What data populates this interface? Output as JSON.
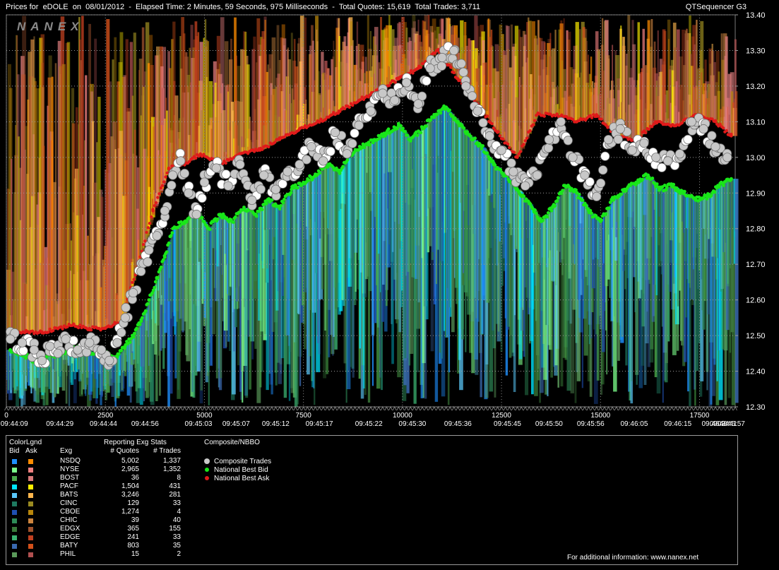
{
  "header": {
    "title_left": "Prices for  eDOLE  on  08/01/2012  -  Elapsed Time: 2 Minutes, 59 Seconds, 975 Milliseconds  -  Total Quotes: 15,619  Total Trades: 3,711",
    "title_right": "QTSequencer G3"
  },
  "watermark": "NANEX",
  "chart_data": {
    "type": "line",
    "y_axis": {
      "min": 12.3,
      "max": 13.4,
      "ticks": [
        "13.40",
        "13.30",
        "13.20",
        "13.10",
        "13.00",
        "12.90",
        "12.80",
        "12.70",
        "12.60",
        "12.50",
        "12.40",
        "12.30"
      ]
    },
    "x_axis": {
      "min": 0,
      "max": 18400,
      "seq_ticks": [
        {
          "v": 0,
          "label": "0"
        },
        {
          "v": 2500,
          "label": "2500"
        },
        {
          "v": 5000,
          "label": "5000"
        },
        {
          "v": 7500,
          "label": "7500"
        },
        {
          "v": 10000,
          "label": "10000"
        },
        {
          "v": 12500,
          "label": "12500"
        },
        {
          "v": 15000,
          "label": "15000"
        },
        {
          "v": 17500,
          "label": "17500"
        }
      ],
      "time_ticks": [
        {
          "v": 200,
          "label": "09:44:09"
        },
        {
          "v": 1350,
          "label": "09:44:29"
        },
        {
          "v": 2450,
          "label": "09:44:44"
        },
        {
          "v": 3500,
          "label": "09:44:56"
        },
        {
          "v": 4850,
          "label": "09:45:03"
        },
        {
          "v": 5800,
          "label": "09:45:07"
        },
        {
          "v": 6800,
          "label": "09:45:12"
        },
        {
          "v": 7900,
          "label": "09:45:17"
        },
        {
          "v": 9150,
          "label": "09:45:22"
        },
        {
          "v": 10250,
          "label": "09:45:30"
        },
        {
          "v": 11400,
          "label": "09:45:36"
        },
        {
          "v": 12650,
          "label": "09:45:45"
        },
        {
          "v": 13700,
          "label": "09:45:50"
        },
        {
          "v": 14750,
          "label": "09:45:56"
        },
        {
          "v": 15850,
          "label": "09:46:05"
        },
        {
          "v": 16950,
          "label": "09:46:15"
        },
        {
          "v": 17900,
          "label": "09:46:24"
        },
        {
          "v": 18100,
          "label": "09:46:41"
        },
        {
          "v": 18300,
          "label": "09:46:57"
        }
      ]
    },
    "series": [
      {
        "name": "Composite Trades",
        "color": "#c8c8c8",
        "points": [
          [
            100,
            12.49
          ],
          [
            400,
            12.48
          ],
          [
            700,
            12.46
          ],
          [
            900,
            12.43
          ],
          [
            1100,
            12.47
          ],
          [
            1300,
            12.45
          ],
          [
            1500,
            12.49
          ],
          [
            1800,
            12.46
          ],
          [
            2100,
            12.48
          ],
          [
            2400,
            12.46
          ],
          [
            2600,
            12.43
          ],
          [
            2800,
            12.48
          ],
          [
            3000,
            12.55
          ],
          [
            3200,
            12.62
          ],
          [
            3400,
            12.68
          ],
          [
            3600,
            12.74
          ],
          [
            3800,
            12.78
          ],
          [
            4000,
            12.85
          ],
          [
            4200,
            12.95
          ],
          [
            4400,
            12.99
          ],
          [
            4600,
            12.9
          ],
          [
            4800,
            12.84
          ],
          [
            5000,
            12.93
          ],
          [
            5300,
            12.97
          ],
          [
            5600,
            12.92
          ],
          [
            5900,
            12.98
          ],
          [
            6200,
            12.88
          ],
          [
            6500,
            12.95
          ],
          [
            6800,
            12.91
          ],
          [
            7100,
            12.96
          ],
          [
            7400,
            12.98
          ],
          [
            7700,
            13.03
          ],
          [
            8000,
            12.99
          ],
          [
            8300,
            13.07
          ],
          [
            8600,
            13.01
          ],
          [
            8900,
            13.09
          ],
          [
            9200,
            13.13
          ],
          [
            9500,
            13.18
          ],
          [
            9800,
            13.16
          ],
          [
            10100,
            13.21
          ],
          [
            10400,
            13.15
          ],
          [
            10700,
            13.25
          ],
          [
            11000,
            13.28
          ],
          [
            11300,
            13.3
          ],
          [
            11600,
            13.2
          ],
          [
            11900,
            13.13
          ],
          [
            12200,
            13.06
          ],
          [
            12500,
            13.02
          ],
          [
            12800,
            12.96
          ],
          [
            13100,
            12.92
          ],
          [
            13400,
            12.95
          ],
          [
            13700,
            13.05
          ],
          [
            14000,
            13.1
          ],
          [
            14300,
            13.0
          ],
          [
            14600,
            12.95
          ],
          [
            14900,
            12.89
          ],
          [
            15200,
            13.05
          ],
          [
            15500,
            13.08
          ],
          [
            15800,
            13.02
          ],
          [
            16100,
            13.04
          ],
          [
            16400,
            13.0
          ],
          [
            16700,
            12.99
          ],
          [
            17000,
            13.01
          ],
          [
            17300,
            13.1
          ],
          [
            17600,
            13.08
          ],
          [
            17900,
            13.03
          ],
          [
            18200,
            13.0
          ]
        ]
      },
      {
        "name": "National Best Bid",
        "color": "#19e619",
        "points": [
          [
            100,
            12.46
          ],
          [
            400,
            12.45
          ],
          [
            700,
            12.43
          ],
          [
            1000,
            12.44
          ],
          [
            1300,
            12.45
          ],
          [
            1600,
            12.46
          ],
          [
            1900,
            12.47
          ],
          [
            2200,
            12.45
          ],
          [
            2500,
            12.45
          ],
          [
            2800,
            12.44
          ],
          [
            3000,
            12.47
          ],
          [
            3200,
            12.5
          ],
          [
            3400,
            12.54
          ],
          [
            3600,
            12.6
          ],
          [
            3800,
            12.66
          ],
          [
            4000,
            12.72
          ],
          [
            4200,
            12.8
          ],
          [
            4500,
            12.82
          ],
          [
            4800,
            12.85
          ],
          [
            5100,
            12.8
          ],
          [
            5400,
            12.84
          ],
          [
            5700,
            12.82
          ],
          [
            6000,
            12.86
          ],
          [
            6300,
            12.84
          ],
          [
            6600,
            12.88
          ],
          [
            6900,
            12.86
          ],
          [
            7200,
            12.91
          ],
          [
            7500,
            12.93
          ],
          [
            7800,
            12.95
          ],
          [
            8100,
            12.98
          ],
          [
            8400,
            12.96
          ],
          [
            8700,
            13.01
          ],
          [
            9000,
            13.03
          ],
          [
            9300,
            13.05
          ],
          [
            9600,
            13.07
          ],
          [
            9900,
            13.09
          ],
          [
            10200,
            13.05
          ],
          [
            10500,
            13.08
          ],
          [
            10800,
            13.12
          ],
          [
            11100,
            13.14
          ],
          [
            11400,
            13.1
          ],
          [
            11700,
            13.06
          ],
          [
            12000,
            13.03
          ],
          [
            12300,
            12.98
          ],
          [
            12600,
            12.95
          ],
          [
            12900,
            12.91
          ],
          [
            13200,
            12.87
          ],
          [
            13500,
            12.82
          ],
          [
            13800,
            12.86
          ],
          [
            14100,
            12.92
          ],
          [
            14400,
            12.9
          ],
          [
            14700,
            12.85
          ],
          [
            15000,
            12.82
          ],
          [
            15300,
            12.88
          ],
          [
            15600,
            12.91
          ],
          [
            15900,
            12.93
          ],
          [
            16200,
            12.95
          ],
          [
            16500,
            12.91
          ],
          [
            16800,
            12.92
          ],
          [
            17100,
            12.9
          ],
          [
            17400,
            12.88
          ],
          [
            17700,
            12.89
          ],
          [
            18000,
            12.92
          ],
          [
            18300,
            12.94
          ]
        ]
      },
      {
        "name": "National Best Ask",
        "color": "#e01a1a",
        "points": [
          [
            100,
            12.51
          ],
          [
            500,
            12.51
          ],
          [
            900,
            12.51
          ],
          [
            1300,
            12.52
          ],
          [
            1700,
            12.53
          ],
          [
            2100,
            12.52
          ],
          [
            2500,
            12.52
          ],
          [
            2900,
            12.54
          ],
          [
            3300,
            12.69
          ],
          [
            3700,
            12.85
          ],
          [
            4100,
            12.97
          ],
          [
            4500,
            12.98
          ],
          [
            4900,
            13.01
          ],
          [
            5400,
            12.98
          ],
          [
            5900,
            13.01
          ],
          [
            6400,
            13.02
          ],
          [
            6900,
            13.05
          ],
          [
            7400,
            13.08
          ],
          [
            7900,
            13.1
          ],
          [
            8400,
            13.13
          ],
          [
            8900,
            13.16
          ],
          [
            9400,
            13.19
          ],
          [
            9900,
            13.22
          ],
          [
            10400,
            13.25
          ],
          [
            10900,
            13.3
          ],
          [
            11400,
            13.22
          ],
          [
            11900,
            13.15
          ],
          [
            12400,
            13.07
          ],
          [
            12900,
            13.0
          ],
          [
            13400,
            13.12
          ],
          [
            13900,
            13.12
          ],
          [
            14400,
            13.1
          ],
          [
            14900,
            13.12
          ],
          [
            15400,
            13.06
          ],
          [
            15900,
            13.05
          ],
          [
            16400,
            13.1
          ],
          [
            16900,
            13.09
          ],
          [
            17400,
            13.12
          ],
          [
            17900,
            13.1
          ],
          [
            18300,
            13.06
          ]
        ]
      }
    ]
  },
  "legend": {
    "color_legend_title": "ColorLgnd",
    "bid_label": "Bid",
    "ask_label": "Ask",
    "exg_header": "Exg",
    "stats_title": "Reporting Exg Stats",
    "quotes_header": "# Quotes",
    "trades_header": "# Trades",
    "composite_title": "Composite/NBBO",
    "composite_items": [
      {
        "label": "Composite Trades",
        "color": "#c8c8c8"
      },
      {
        "label": "National Best Bid",
        "color": "#19e619"
      },
      {
        "label": "National Best Ask",
        "color": "#e01a1a"
      }
    ],
    "exchanges": [
      {
        "name": "NSDQ",
        "quotes": "5,002",
        "trades": "1,337",
        "bid_color": "#1e90ff",
        "ask_color": "#ff8c00"
      },
      {
        "name": "NYSE",
        "quotes": "2,965",
        "trades": "1,352",
        "bid_color": "#7cfc8a",
        "ask_color": "#f08080"
      },
      {
        "name": "BOST",
        "quotes": "36",
        "trades": "8",
        "bid_color": "#4aa84a",
        "ask_color": "#d87a7a"
      },
      {
        "name": "PACF",
        "quotes": "1,504",
        "trades": "431",
        "bid_color": "#00e5ff",
        "ask_color": "#ffee00"
      },
      {
        "name": "BATS",
        "quotes": "3,246",
        "trades": "281",
        "bid_color": "#5ac8fa",
        "ask_color": "#ffb74d"
      },
      {
        "name": "CINC",
        "quotes": "129",
        "trades": "33",
        "bid_color": "#1e7a60",
        "ask_color": "#9a8a20"
      },
      {
        "name": "CBOE",
        "quotes": "1,274",
        "trades": "4",
        "bid_color": "#1f4fb0",
        "ask_color": "#b8860b"
      },
      {
        "name": "CHIC",
        "quotes": "39",
        "trades": "40",
        "bid_color": "#2e8b57",
        "ask_color": "#cd853f"
      },
      {
        "name": "EDGX",
        "quotes": "365",
        "trades": "155",
        "bid_color": "#3a7a3a",
        "ask_color": "#a0522d"
      },
      {
        "name": "EDGE",
        "quotes": "241",
        "trades": "33",
        "bid_color": "#3cb371",
        "ask_color": "#c04020"
      },
      {
        "name": "BATY",
        "quotes": "803",
        "trades": "35",
        "bid_color": "#3a6ab0",
        "ask_color": "#d2501a"
      },
      {
        "name": "PHIL",
        "quotes": "15",
        "trades": "2",
        "bid_color": "#5a9a5a",
        "ask_color": "#b05050"
      }
    ],
    "footer": "For additional information: www.nanex.net"
  }
}
